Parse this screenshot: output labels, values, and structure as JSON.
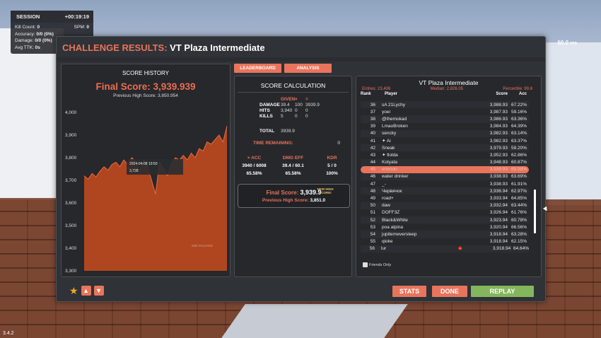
{
  "version": "3.4.2",
  "fps": {
    "value": "60.0",
    "unit": "FPS"
  },
  "session": {
    "label": "SESSION",
    "time": "+00:19:19",
    "kill_count_label": "Kill Count:",
    "kill_count": "0",
    "spm_label": "SPM:",
    "spm": "0",
    "accuracy_label": "Accuracy:",
    "accuracy": "0/0 (0%)",
    "damage_label": "Damage:",
    "damage": "0/0 (0%)",
    "avg_ttk_label": "Avg TTK:",
    "avg_ttk": "0s"
  },
  "dialog": {
    "title_label": "CHALLENGE RESULTS:",
    "title_name": "VT Plaza Intermediate"
  },
  "tabs": {
    "leaderboard": "LEADERBOARD",
    "analysis": "ANALYSIS"
  },
  "history": {
    "title": "SCORE HISTORY",
    "final_score": "Final Score: 3,939.939",
    "previous_high": "Previous High Score: 3,850.954",
    "tooltip_date": "2024-04-08 19:50",
    "tooltip_value": "3,728",
    "percentile_label": "50th Percentile"
  },
  "chart_data": {
    "type": "area",
    "y_ticks": [
      "4,000",
      "3,900",
      "3,800",
      "3,700",
      "3,600",
      "3,500",
      "3,400",
      "3,300"
    ],
    "ylim": [
      3300,
      4000
    ],
    "values": [
      3720,
      3705,
      3730,
      3715,
      3740,
      3760,
      3745,
      3770,
      3780,
      3760,
      3790,
      3770,
      3800,
      3785,
      3740,
      3790,
      3760,
      3700,
      3640,
      3780,
      3750,
      3720,
      3770,
      3800,
      3790,
      3810,
      3790,
      3820,
      3800,
      3840,
      3830,
      3870,
      3860,
      3880,
      3900,
      3870,
      3940
    ],
    "colors": {
      "fill": "#c84b1f",
      "line": "#f06a3c"
    }
  },
  "calc": {
    "title": "SCORE CALCULATION",
    "col_given": "GIVEN",
    "col_x": "×",
    "col_eq": "=",
    "rows": [
      {
        "label": "DAMAGE",
        "given": "39.4",
        "mult": "100",
        "total": "3939.9"
      },
      {
        "label": "HITS",
        "given": "3,940",
        "mult": "0",
        "total": "0"
      },
      {
        "label": "KILLS",
        "given": "5",
        "mult": "0",
        "total": "0"
      }
    ],
    "total_label": "TOTAL",
    "total_value": "3939.9",
    "time_label": "TIME REMAINING:",
    "time_value": "0",
    "acc_label": "× ACC",
    "acc_v1": "3940 / 6008",
    "acc_v2": "65.58%",
    "dmg_label": "DMG EFF",
    "dmg_v1": "39.4 / 60.1",
    "dmg_v2": "65.58%",
    "kdr_label": "KDR",
    "kdr_v1": "5 / 0",
    "kdr_v2": "100%",
    "final_label": "Final Score:",
    "final_value": "3,939.9",
    "new_high": "NEW HIGH SCORE!",
    "prev_label": "Previous High Score:",
    "prev_value": "3,851.0"
  },
  "leaderboard": {
    "title": "VT Plaza Intermediate",
    "entries": "Entries: 23,406",
    "median": "Median: 2,826.05",
    "percentile": "Percentile: 99.8",
    "col_rank": "Rank",
    "col_player": "Player",
    "col_score": "Score",
    "col_acc": "Acc",
    "friends_only": "Friends Only",
    "rows": [
      {
        "rank": "36",
        "player": "sA 21Lychy",
        "score": "3,988.93",
        "acc": "67.22%"
      },
      {
        "rank": "37",
        "player": "yoei",
        "score": "3,987.93",
        "acc": "59.16%"
      },
      {
        "rank": "38",
        "player": "@themokad",
        "score": "3,986.93",
        "acc": "63.36%"
      },
      {
        "rank": "39",
        "player": "LmaoBroken",
        "score": "3,984.93",
        "acc": "64.39%"
      },
      {
        "rank": "40",
        "player": "sencky",
        "score": "3,982.93",
        "acc": "63.14%"
      },
      {
        "rank": "41",
        "player": "✦ Ai",
        "score": "3,982.93",
        "acc": "63.37%"
      },
      {
        "rank": "42",
        "player": "Sneak",
        "score": "3,979.93",
        "acc": "59.20%"
      },
      {
        "rank": "43",
        "player": "✦ tlolda",
        "score": "3,952.93",
        "acc": "62.86%"
      },
      {
        "rank": "44",
        "player": "Kotyata",
        "score": "3,948.93",
        "acc": "60.87%"
      },
      {
        "rank": "45",
        "player": "emmon",
        "score": "3,939.93",
        "acc": "65.58%",
        "me": true
      },
      {
        "rank": "46",
        "player": "water drinker",
        "score": "3,938.93",
        "acc": "63.69%"
      },
      {
        "rank": "47",
        "player": "_-",
        "score": "3,938.93",
        "acc": "61.91%"
      },
      {
        "rank": "48",
        "player": "Червячок",
        "score": "3,936.94",
        "acc": "62.97%"
      },
      {
        "rank": "49",
        "player": "road+",
        "score": "3,933.94",
        "acc": "64.85%"
      },
      {
        "rank": "50",
        "player": "daw",
        "score": "3,932.94",
        "acc": "63.44%"
      },
      {
        "rank": "51",
        "player": "DOFF3Z",
        "score": "3,926.94",
        "acc": "61.76%"
      },
      {
        "rank": "52",
        "player": "Black&White",
        "score": "3,923.94",
        "acc": "60.78%"
      },
      {
        "rank": "53",
        "player": "poa alpina",
        "score": "3,920.94",
        "acc": "66.56%"
      },
      {
        "rank": "54",
        "player": "jupiterneversleep",
        "score": "3,918.94",
        "acc": "63.28%"
      },
      {
        "rank": "55",
        "player": "qioke",
        "score": "3,918.94",
        "acc": "62.15%"
      },
      {
        "rank": "56",
        "player": "lur",
        "score": "3,918.94",
        "acc": "64.64%",
        "flag": "🍁"
      }
    ]
  },
  "buttons": {
    "stats": "STATS",
    "done": "DONE",
    "replay": "REPLAY"
  },
  "icons": {
    "favorite": "star-icon",
    "like": "thumbs-up-icon",
    "dislike": "thumbs-down-icon"
  }
}
